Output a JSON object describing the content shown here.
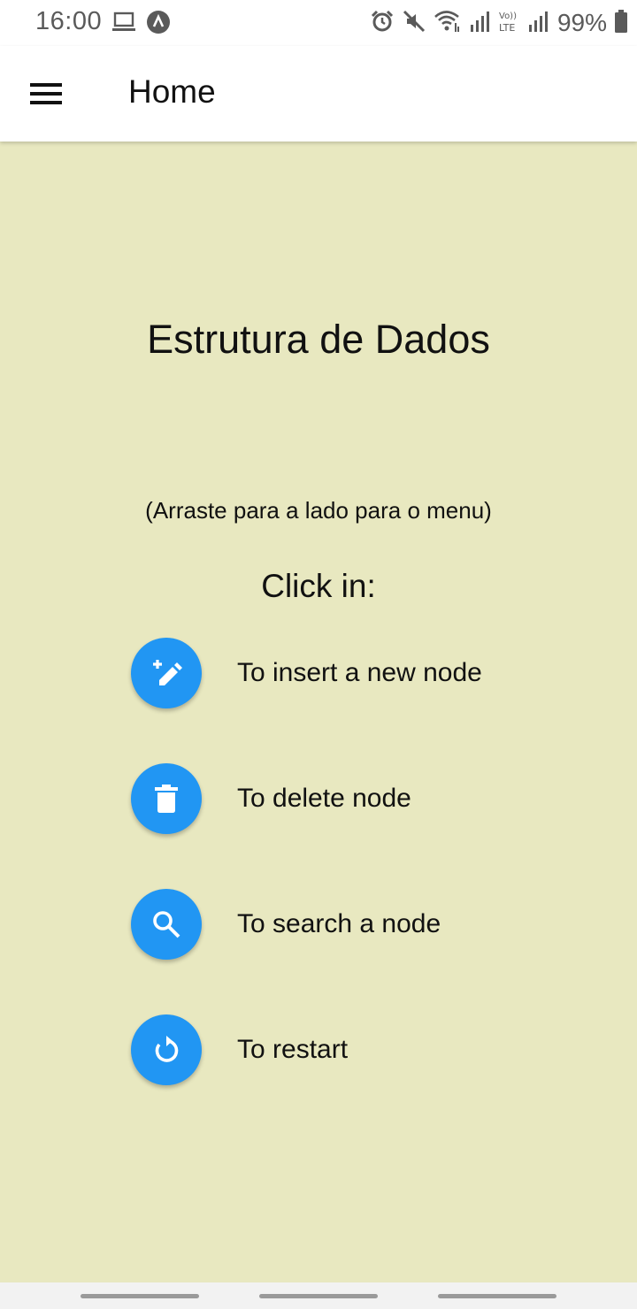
{
  "status_bar": {
    "time": "16:00",
    "battery": "99%",
    "icons": [
      "laptop-icon",
      "app-circle-icon",
      "alarm-icon",
      "mute-icon",
      "wifi-icon",
      "signal-icon",
      "volte-icon",
      "signal-icon",
      "battery-icon"
    ]
  },
  "app_bar": {
    "title": "Home",
    "menu_icon": "hamburger-menu-icon"
  },
  "content": {
    "headline": "Estrutura de Dados",
    "hint": "(Arraste para a lado para o menu)",
    "click_in": "Click in:",
    "actions": [
      {
        "icon": "edit-plus-icon",
        "label": "To insert a new node"
      },
      {
        "icon": "trash-icon",
        "label": "To delete node"
      },
      {
        "icon": "search-icon",
        "label": "To search a node"
      },
      {
        "icon": "restart-icon",
        "label": "To restart"
      }
    ]
  },
  "colors": {
    "background": "#e8e8c0",
    "accent": "#2196f3",
    "app_bar": "#ffffff"
  }
}
